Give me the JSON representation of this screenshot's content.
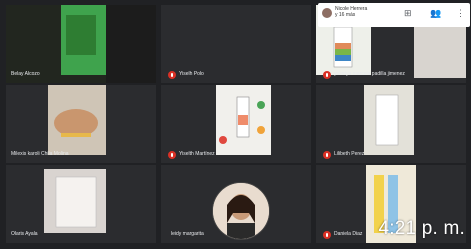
{
  "clock": "4:21 p. m.",
  "top_bar": {
    "label_line1": "Nicole Herrera",
    "label_line2": "y 16 más",
    "buttons": [
      "layout-icon",
      "people-icon",
      "more-icon"
    ]
  },
  "tiles": [
    {
      "name": "Belay Alcozo",
      "muted": false
    },
    {
      "name": "Yiselh Polo",
      "muted": true
    },
    {
      "name": "yulirdya marcela padilla jimenez",
      "muted": true
    },
    {
      "name": "Milexis karoli Chila Molina",
      "muted": false
    },
    {
      "name": "Yiselth Martínez",
      "muted": true
    },
    {
      "name": "Lilibeth Perez",
      "muted": true
    },
    {
      "name": "Olaris Ayala",
      "muted": false
    },
    {
      "name": "leidy margarita",
      "muted": false
    },
    {
      "name": "Daniela Diaz",
      "muted": true
    }
  ],
  "colors": {
    "background": "#202124",
    "mic_muted": "#d93025"
  }
}
